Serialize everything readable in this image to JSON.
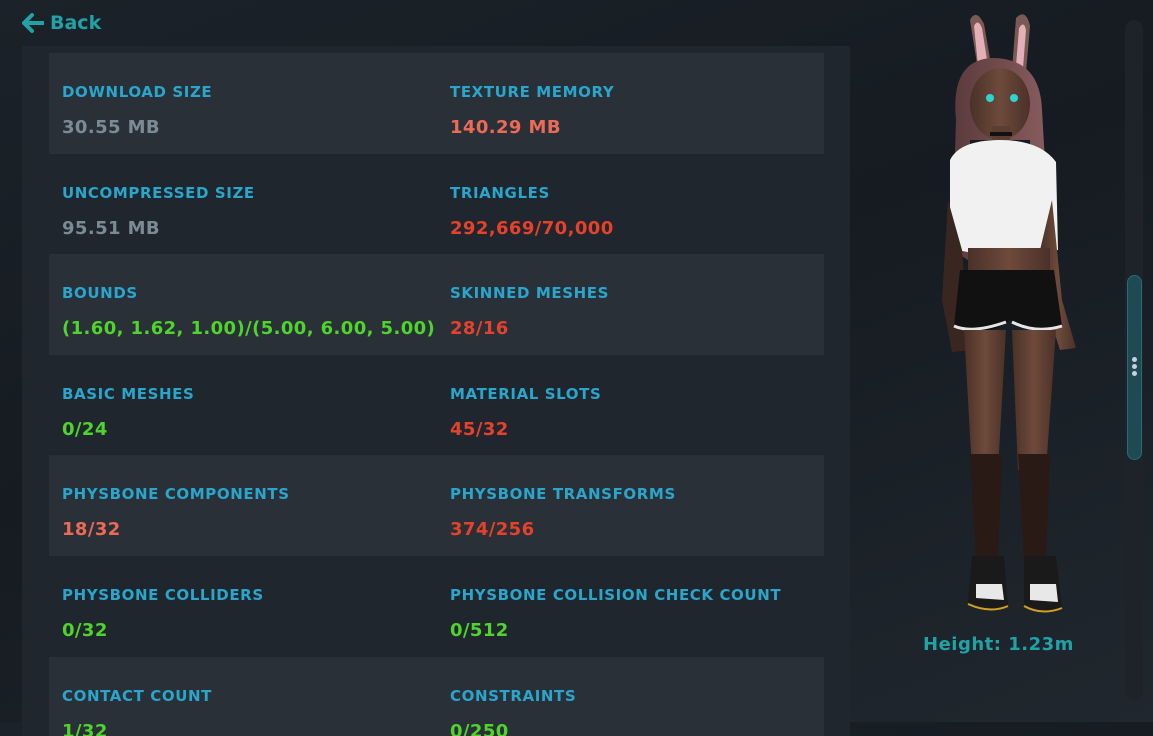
{
  "nav": {
    "back_label": "Back"
  },
  "stats": [
    {
      "left": {
        "label": "DOWNLOAD SIZE",
        "value": "30.55 MB",
        "status": "gray"
      },
      "right": {
        "label": "TEXTURE MEMORY",
        "value": "140.29 MB",
        "status": "salmon"
      }
    },
    {
      "left": {
        "label": "UNCOMPRESSED SIZE",
        "value": "95.51 MB",
        "status": "gray"
      },
      "right": {
        "label": "TRIANGLES",
        "value": "292,669/70,000",
        "status": "red"
      }
    },
    {
      "left": {
        "label": "BOUNDS",
        "value": "(1.60, 1.62, 1.00)/(5.00, 6.00, 5.00)",
        "status": "green"
      },
      "right": {
        "label": "SKINNED MESHES",
        "value": "28/16",
        "status": "red"
      }
    },
    {
      "left": {
        "label": "BASIC MESHES",
        "value": "0/24",
        "status": "green"
      },
      "right": {
        "label": "MATERIAL SLOTS",
        "value": "45/32",
        "status": "red"
      }
    },
    {
      "left": {
        "label": "PHYSBONE COMPONENTS",
        "value": "18/32",
        "status": "salmon"
      },
      "right": {
        "label": "PHYSBONE TRANSFORMS",
        "value": "374/256",
        "status": "red"
      }
    },
    {
      "left": {
        "label": "PHYSBONE COLLIDERS",
        "value": "0/32",
        "status": "green"
      },
      "right": {
        "label": "PHYSBONE COLLISION CHECK COUNT",
        "value": "0/512",
        "status": "green"
      }
    },
    {
      "left": {
        "label": "CONTACT COUNT",
        "value": "1/32",
        "status": "green"
      },
      "right": {
        "label": "CONSTRAINTS",
        "value": "0/250",
        "status": "green"
      }
    }
  ],
  "avatar": {
    "height_text": "Height: 1.23m"
  },
  "colors": {
    "accent": "#1fa3a6",
    "label": "#2aa6cc",
    "gray": "#7b8b95",
    "salmon": "#ec6a56",
    "red": "#e6412a",
    "green": "#4fd42c"
  },
  "icons": {
    "back": "arrow-left-icon",
    "scroll_grip": "vertical-dots-icon"
  }
}
